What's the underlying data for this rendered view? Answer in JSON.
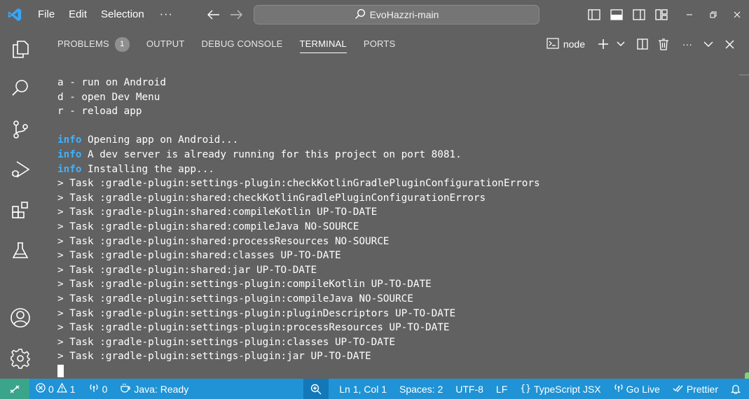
{
  "titlebar": {
    "menu": [
      "File",
      "Edit",
      "Selection"
    ],
    "more": "···",
    "search_text": "EvoHazzri-main"
  },
  "panel": {
    "tabs": [
      {
        "label": "PROBLEMS",
        "badge": "1"
      },
      {
        "label": "OUTPUT"
      },
      {
        "label": "DEBUG CONSOLE"
      },
      {
        "label": "TERMINAL",
        "active": true
      },
      {
        "label": "PORTS"
      }
    ],
    "terminal_name": "node",
    "more": "···"
  },
  "terminal": {
    "lines": [
      "a - run on Android",
      "d - open Dev Menu",
      "r - reload app",
      "",
      "info| Opening app on Android...",
      "info| A dev server is already running for this project on port 8081.",
      "info| Installing the app...",
      "> Task :gradle-plugin:settings-plugin:checkKotlinGradlePluginConfigurationErrors",
      "> Task :gradle-plugin:shared:checkKotlinGradlePluginConfigurationErrors",
      "> Task :gradle-plugin:shared:compileKotlin UP-TO-DATE",
      "> Task :gradle-plugin:shared:compileJava NO-SOURCE",
      "> Task :gradle-plugin:shared:processResources NO-SOURCE",
      "> Task :gradle-plugin:shared:classes UP-TO-DATE",
      "> Task :gradle-plugin:shared:jar UP-TO-DATE",
      "> Task :gradle-plugin:settings-plugin:compileKotlin UP-TO-DATE",
      "> Task :gradle-plugin:settings-plugin:compileJava NO-SOURCE",
      "> Task :gradle-plugin:settings-plugin:pluginDescriptors UP-TO-DATE",
      "> Task :gradle-plugin:settings-plugin:processResources UP-TO-DATE",
      "> Task :gradle-plugin:settings-plugin:classes UP-TO-DATE",
      "> Task :gradle-plugin:settings-plugin:jar UP-TO-DATE"
    ]
  },
  "statusbar": {
    "errors": "0",
    "warnings": "1",
    "ports": "0",
    "java": "Java: Ready",
    "position": "Ln 1, Col 1",
    "spaces": "Spaces: 2",
    "encoding": "UTF-8",
    "eol": "LF",
    "language": "TypeScript JSX",
    "go_live": "Go Live",
    "prettier": "Prettier"
  },
  "colors": {
    "background": "#616161",
    "statusbar": "#1f93d5",
    "remote": "#3aa58a",
    "info": "#3fb2ff"
  }
}
